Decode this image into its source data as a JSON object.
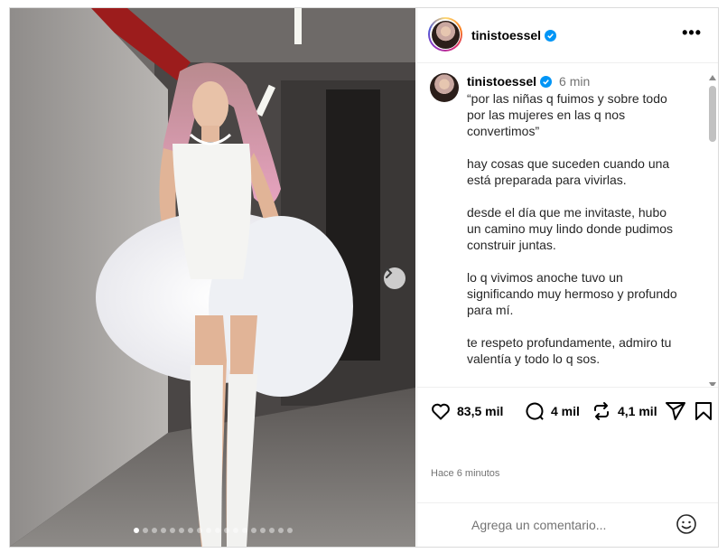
{
  "post": {
    "username": "tinistoessel",
    "time_ago": "6 min",
    "caption_lines": [
      "“por las niñas q fuimos y sobre todo por las mujeres en las q nos convertimos”",
      "hay cosas que suceden cuando una está preparada para vivirlas.",
      "desde el día que me invitaste, hubo un camino muy lindo donde pudimos construir juntas.",
      "lo q vivimos anoche tuvo un significando muy hermoso y profundo para mí.",
      "te respeto profundamente, admiro tu valentía y todo lo q sos."
    ],
    "likes": "83,5 mil",
    "comments": "4 mil",
    "reposts": "4,1 mil",
    "timestamp": "Hace 6 minutos",
    "comment_placeholder": "Agrega un comentario..."
  },
  "media": {
    "carousel_total": 18,
    "carousel_active": 1
  },
  "icons": {
    "verified": "verified-badge-icon",
    "more": "more-options-icon",
    "like": "heart-icon",
    "comment": "comment-bubble-icon",
    "repost": "repost-icon",
    "share": "send-icon",
    "save": "bookmark-icon",
    "emoji": "emoji-icon",
    "next": "chevron-right-icon"
  },
  "colors": {
    "verified_blue": "#0095f6",
    "border": "#dbdbdb",
    "muted_text": "#737373"
  }
}
